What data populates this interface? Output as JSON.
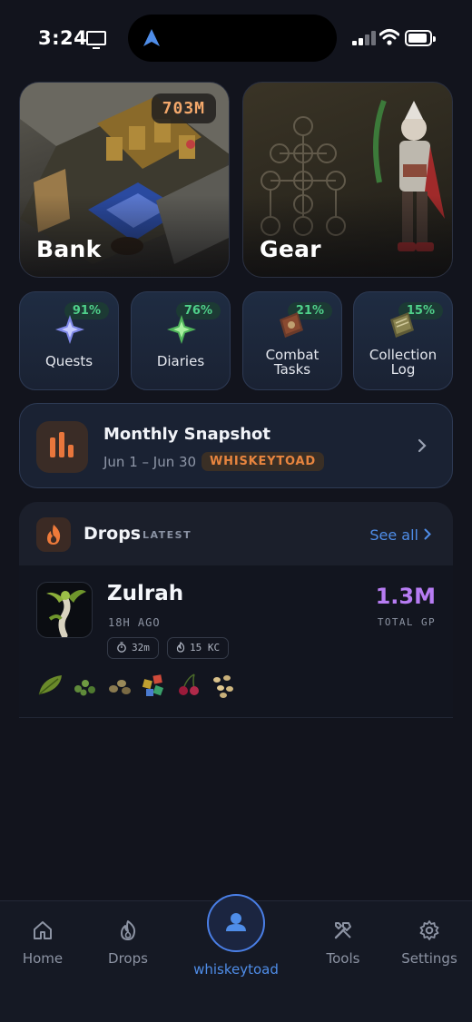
{
  "status_bar": {
    "time": "3:24"
  },
  "cards": {
    "bank": {
      "title": "Bank",
      "value": "703M"
    },
    "gear": {
      "title": "Gear"
    }
  },
  "tiles": [
    {
      "label": "Quests",
      "percent": "91%",
      "icon": "quest-star-icon"
    },
    {
      "label": "Diaries",
      "percent": "76%",
      "icon": "diary-star-icon"
    },
    {
      "label_lines": [
        "Combat",
        "Tasks"
      ],
      "percent": "21%",
      "icon": "combat-book-icon"
    },
    {
      "label_lines": [
        "Collection",
        "Log"
      ],
      "percent": "15%",
      "icon": "collection-log-book-icon"
    }
  ],
  "snapshot": {
    "title": "Monthly Snapshot",
    "range": "Jun 1 – Jun 30",
    "badge": "WHISKEYTOAD"
  },
  "drops": {
    "title": "Drops",
    "subtitle": "LATEST",
    "see_all": "See all",
    "latest": {
      "npc": "Zulrah",
      "time_ago": "18H AGO",
      "duration": "32m",
      "kc": "15 KC",
      "total_value": "1.3M",
      "total_label": "TOTAL GP",
      "items": [
        "leaf-item-icon",
        "seeds-item-icon",
        "nuts-item-icon",
        "scales-item-icon",
        "cherries-item-icon",
        "tubers-item-icon"
      ]
    }
  },
  "tab_bar": {
    "tabs": [
      {
        "label": "Home",
        "icon": "home-icon"
      },
      {
        "label": "Drops",
        "icon": "flame-icon"
      },
      {
        "label": "whiskeytoad",
        "icon": "profile-icon",
        "active": true
      },
      {
        "label": "Tools",
        "icon": "tools-icon"
      },
      {
        "label": "Settings",
        "icon": "gear-icon"
      }
    ]
  },
  "colors": {
    "background": "#12141d",
    "accent_blue": "#4f8de8",
    "accent_orange": "#e8853f",
    "percent_green": "#4fd08a",
    "value_purple": "#b77cf3"
  }
}
